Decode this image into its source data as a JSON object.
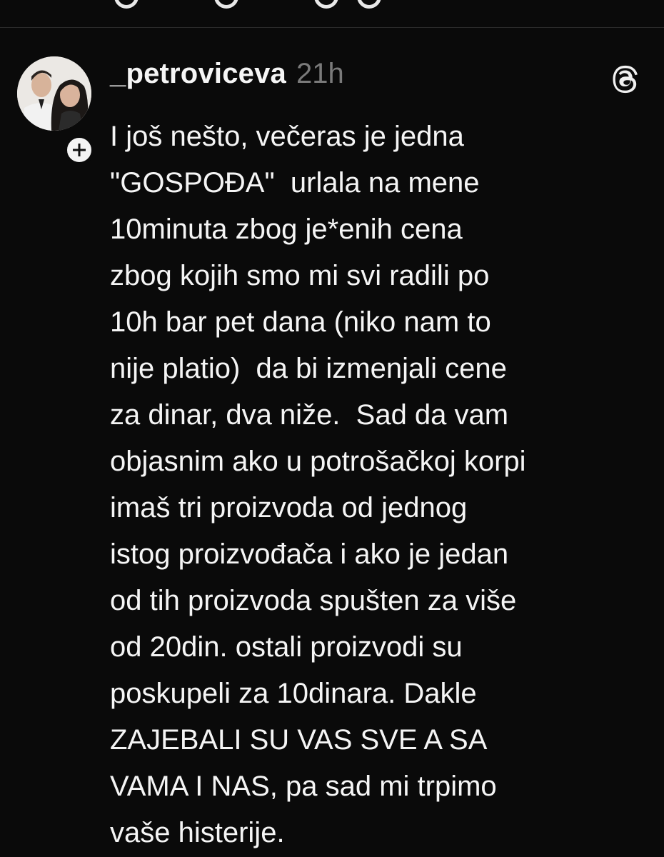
{
  "post": {
    "username": "_petroviceva",
    "time": "21h",
    "lines": [
      "I još nešto, večeras je jedna",
      "\"GOSPOĐA\"  urlala na mene",
      "10minuta zbog je*enih cena",
      "zbog kojih smo mi svi radili po",
      "10h bar pet dana (niko nam to",
      "nije platio)  da bi izmenjali cene",
      "za dinar, dva niže.  Sad da vam",
      "objasnim ako u potrošačkoj korpi",
      "imaš tri proizvoda od jednog",
      "istog proizvođača i ako je jedan",
      "od tih proizvoda spušten za više",
      "od 20din. ostali proizvodi su",
      "poskupeli za 10dinara. Dakle",
      "ZAJEBALI SU VAS SVE A SA",
      "VAMA I NAS, pa sad mi trpimo",
      "vaše histerije."
    ],
    "icons": {
      "avatar": "avatar",
      "follow": "plus-icon",
      "app": "threads-logo-icon"
    }
  }
}
